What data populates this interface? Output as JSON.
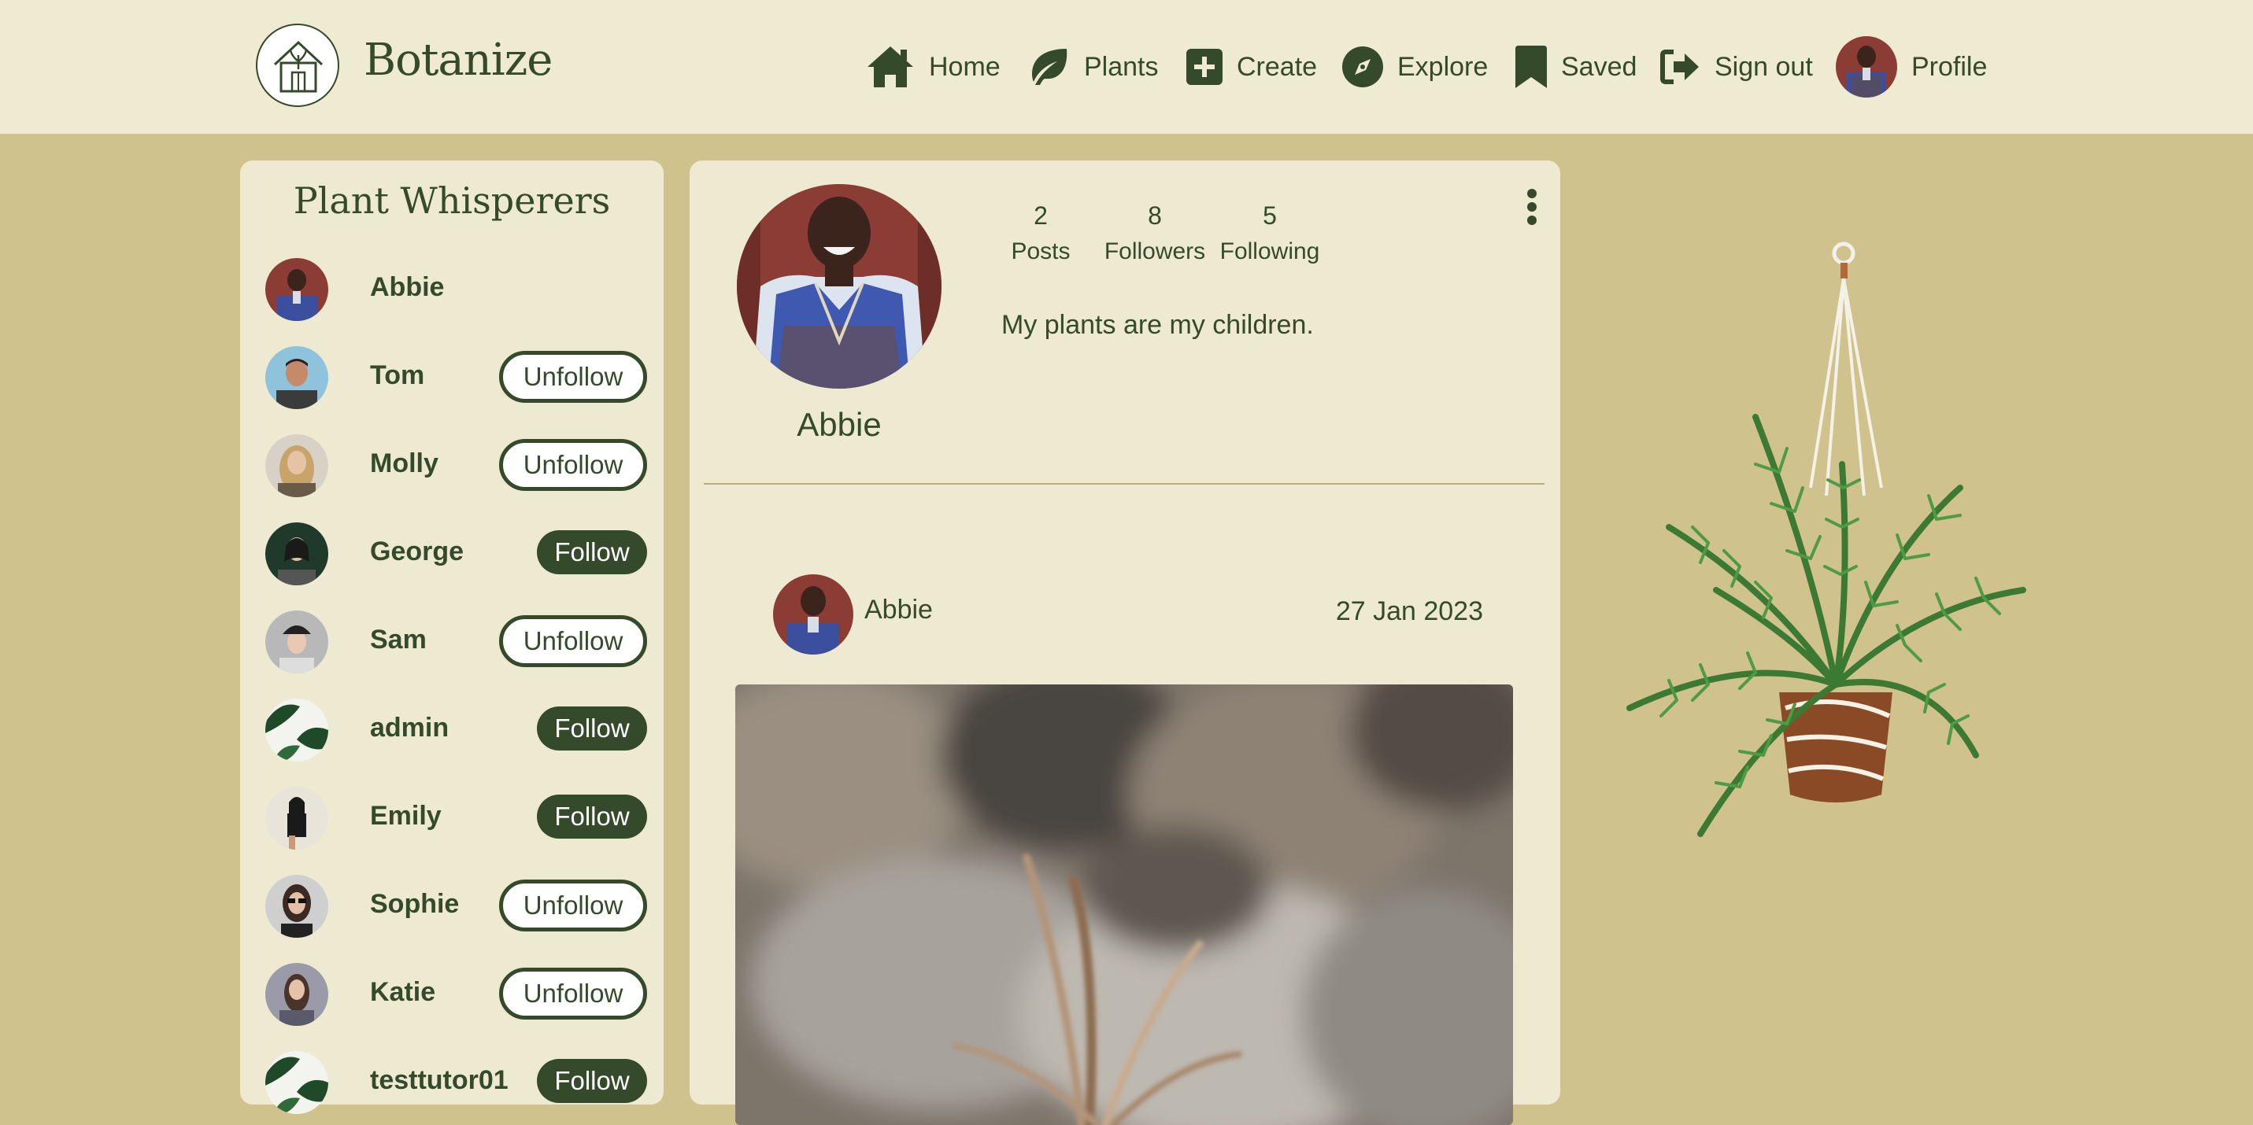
{
  "header": {
    "brand": "Botanize",
    "nav": [
      {
        "label": "Home",
        "icon": "home-icon"
      },
      {
        "label": "Plants",
        "icon": "leaf-icon"
      },
      {
        "label": "Create",
        "icon": "plus-square-icon"
      },
      {
        "label": "Explore",
        "icon": "compass-icon"
      },
      {
        "label": "Saved",
        "icon": "bookmark-icon"
      },
      {
        "label": "Sign out",
        "icon": "sign-out-icon"
      },
      {
        "label": "Profile",
        "icon": "avatar"
      }
    ]
  },
  "sidebar": {
    "title": "Plant Whisperers",
    "users": [
      {
        "name": "Abbie",
        "button": ""
      },
      {
        "name": "Tom",
        "button": "Unfollow"
      },
      {
        "name": "Molly",
        "button": "Unfollow"
      },
      {
        "name": "George",
        "button": "Follow"
      },
      {
        "name": "Sam",
        "button": "Unfollow"
      },
      {
        "name": "admin",
        "button": "Follow"
      },
      {
        "name": "Emily",
        "button": "Follow"
      },
      {
        "name": "Sophie",
        "button": "Unfollow"
      },
      {
        "name": "Katie",
        "button": "Unfollow"
      },
      {
        "name": "testtutor01",
        "button": "Follow"
      }
    ]
  },
  "profile": {
    "name": "Abbie",
    "stats": [
      {
        "value": "2",
        "label": "Posts"
      },
      {
        "value": "8",
        "label": "Followers"
      },
      {
        "value": "5",
        "label": "Following"
      }
    ],
    "bio": "My plants are my children."
  },
  "post": {
    "author": "Abbie",
    "date": "27 Jan 2023"
  },
  "colors": {
    "background": "#cfc28c",
    "header_bg": "#efead2",
    "panel_bg": "#eee9d1",
    "primary": "#344a2a"
  }
}
